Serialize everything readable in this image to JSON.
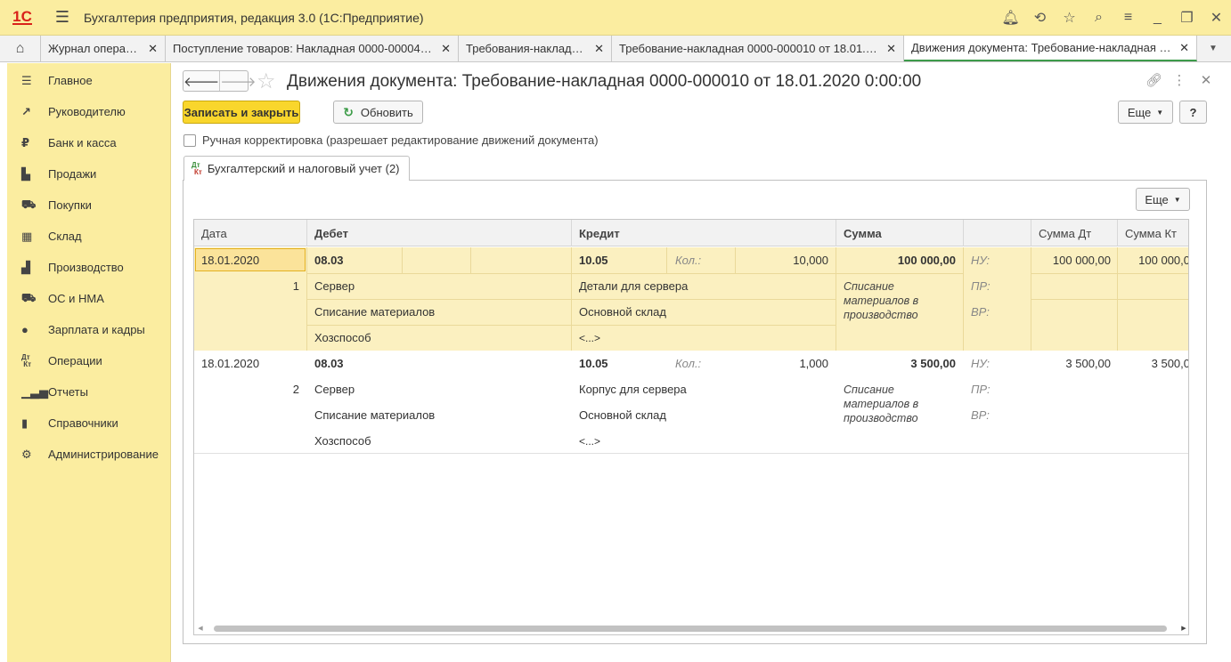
{
  "app": {
    "title": "Бухгалтерия предприятия, редакция 3.0  (1С:Предприятие)",
    "logo": "1С"
  },
  "tabs": [
    {
      "label": "Журнал операций",
      "active": false
    },
    {
      "label": "Поступление товаров: Накладная 0000-000043...",
      "active": false
    },
    {
      "label": "Требования-накладные",
      "active": false
    },
    {
      "label": "Требование-накладная 0000-000010 от 18.01.2...",
      "active": false
    },
    {
      "label": "Движения документа: Требование-накладная 0...",
      "active": true
    }
  ],
  "sidebar": {
    "items": [
      {
        "label": "Главное",
        "icon": "list-icon"
      },
      {
        "label": "Руководителю",
        "icon": "trend-icon"
      },
      {
        "label": "Банк и касса",
        "icon": "ruble-icon"
      },
      {
        "label": "Продажи",
        "icon": "bag-icon"
      },
      {
        "label": "Покупки",
        "icon": "cart-icon"
      },
      {
        "label": "Склад",
        "icon": "warehouse-icon"
      },
      {
        "label": "Производство",
        "icon": "factory-icon"
      },
      {
        "label": "ОС и НМА",
        "icon": "truck-icon"
      },
      {
        "label": "Зарплата и кадры",
        "icon": "person-icon"
      },
      {
        "label": "Операции",
        "icon": "dtkt-icon"
      },
      {
        "label": "Отчеты",
        "icon": "bar-chart-icon"
      },
      {
        "label": "Справочники",
        "icon": "book-icon"
      },
      {
        "label": "Администрирование",
        "icon": "gear-icon"
      }
    ]
  },
  "doc": {
    "title": "Движения документа: Требование-накладная 0000-000010 от 18.01.2020 0:00:00",
    "save_close": "Записать и закрыть",
    "refresh": "Обновить",
    "more": "Еще",
    "help": "?",
    "manual_correction": "Ручная корректировка (разрешает редактирование движений документа)",
    "panel_tab": "Бухгалтерский и налоговый учет (2)",
    "panel_more": "Еще"
  },
  "grid": {
    "headers": {
      "date": "Дата",
      "debit": "Дебет",
      "credit": "Кредит",
      "sum": "Сумма",
      "type": "",
      "sum_dt": "Сумма Дт",
      "sum_kt": "Сумма Кт"
    },
    "rows": [
      {
        "date": "18.01.2020",
        "num": "1",
        "debit_account": "08.03",
        "debit_sub": [
          "Сервер",
          "Списание материалов",
          "Хозспособ"
        ],
        "credit_account": "10.05",
        "qty_label": "Кол.:",
        "qty": "10,000",
        "credit_sub": [
          "Детали для сервера",
          "Основной склад",
          "<...>"
        ],
        "sum": "100 000,00",
        "content": "Списание материалов в производство",
        "types": [
          "НУ:",
          "ПР:",
          "ВР:"
        ],
        "sum_dt": "100 000,00",
        "sum_kt": "100 000,0"
      },
      {
        "date": "18.01.2020",
        "num": "2",
        "debit_account": "08.03",
        "debit_sub": [
          "Сервер",
          "Списание материалов",
          "Хозспособ"
        ],
        "credit_account": "10.05",
        "qty_label": "Кол.:",
        "qty": "1,000",
        "credit_sub": [
          "Корпус для сервера",
          "Основной склад",
          "<...>"
        ],
        "sum": "3 500,00",
        "content": "Списание материалов в производство",
        "types": [
          "НУ:",
          "ПР:",
          "ВР:"
        ],
        "sum_dt": "3 500,00",
        "sum_kt": "3 500,0"
      }
    ]
  }
}
